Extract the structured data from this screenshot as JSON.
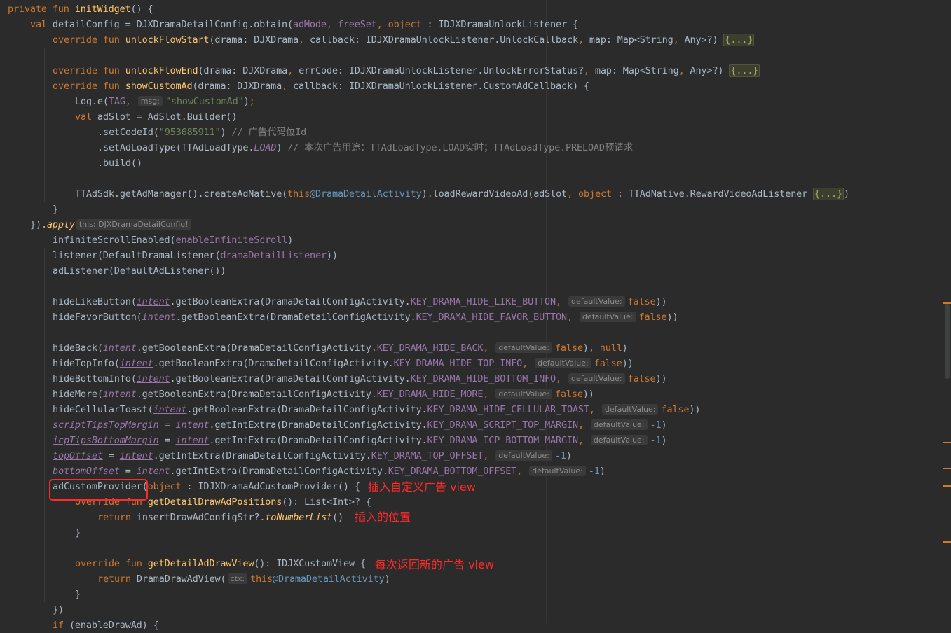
{
  "editor": {
    "lines": [
      [
        [
          "kw",
          "private fun "
        ],
        [
          "fn",
          "initWidget"
        ],
        [
          "",
          "() {"
        ]
      ],
      [
        [
          "kw",
          "val "
        ],
        [
          "",
          "detailConfig = DJXDramaDetailConfig.obtain("
        ],
        [
          "prop",
          "adMode"
        ],
        [
          "kw",
          ", "
        ],
        [
          "prop",
          "freeSet"
        ],
        [
          "kw",
          ", "
        ],
        [
          "kw",
          "object "
        ],
        [
          "",
          ": IDJXDramaUnlockListener {"
        ]
      ],
      [
        [
          "kw",
          "override fun "
        ],
        [
          "fn",
          "unlockFlowStart"
        ],
        [
          "",
          "(drama: DJXDrama"
        ],
        [
          "kw",
          ", "
        ],
        [
          "",
          "callback: IDJXDramaUnlockListener.UnlockCallback"
        ],
        [
          "kw",
          ", "
        ],
        [
          "",
          "map: Map<String"
        ],
        [
          "kw",
          ", "
        ],
        [
          "",
          "Any>?) "
        ],
        [
          "fold",
          "{...}"
        ]
      ],
      [],
      [
        [
          "kw",
          "override fun "
        ],
        [
          "fn",
          "unlockFlowEnd"
        ],
        [
          "",
          "(drama: DJXDrama"
        ],
        [
          "kw",
          ", "
        ],
        [
          "",
          "errCode: IDJXDramaUnlockListener.UnlockErrorStatus?"
        ],
        [
          "kw",
          ", "
        ],
        [
          "",
          "map: Map<String"
        ],
        [
          "kw",
          ", "
        ],
        [
          "",
          "Any>?) "
        ],
        [
          "fold",
          "{...}"
        ]
      ],
      [
        [
          "kw",
          "override fun "
        ],
        [
          "fn",
          "showCustomAd"
        ],
        [
          "",
          "(drama: DJXDrama"
        ],
        [
          "kw",
          ", "
        ],
        [
          "",
          "callback: IDJXDramaUnlockListener.CustomAdCallback) {"
        ]
      ],
      [
        [
          "",
          "Log.e("
        ],
        [
          "prop",
          "TAG"
        ],
        [
          "kw",
          ", "
        ],
        [
          "hint",
          "msg:"
        ],
        [
          "str",
          "\"showCustomAd\""
        ],
        [
          "",
          ")"
        ],
        [
          "kw",
          ";"
        ]
      ],
      [
        [
          "kw",
          "val "
        ],
        [
          "",
          "adSlot = AdSlot.Builder()"
        ]
      ],
      [
        [
          "",
          ".setCodeId("
        ],
        [
          "str",
          "\"953685911\""
        ],
        [
          "",
          ") "
        ],
        [
          "cm",
          "// 广告代码位Id"
        ]
      ],
      [
        [
          "",
          ".setAdLoadType(TTAdLoadType."
        ],
        [
          "iprop",
          "LOAD"
        ],
        [
          "",
          ") "
        ],
        [
          "cm",
          "// 本次广告用途：TTAdLoadType.LOAD实时；TTAdLoadType.PRELOAD预请求"
        ]
      ],
      [
        [
          "",
          ".build()"
        ]
      ],
      [],
      [
        [
          "",
          "TTAdSdk.getAdManager().createAdNative("
        ],
        [
          "kw",
          "this"
        ],
        [
          "label",
          "@DramaDetailActivity"
        ],
        [
          "",
          ").loadRewardVideoAd(adSlot"
        ],
        [
          "kw",
          ", "
        ],
        [
          "kw",
          "object "
        ],
        [
          "",
          ": TTAdNative.RewardVideoAdListener "
        ],
        [
          "fold",
          "{...}"
        ],
        [
          "",
          ")"
        ]
      ],
      [
        [
          "",
          "}"
        ]
      ],
      [
        [
          "",
          "})."
        ],
        [
          "ext",
          "apply"
        ],
        [
          "",
          ""
        ],
        [
          "hint",
          "this: DJXDramaDetailConfig!"
        ],
        [
          "",
          ""
        ]
      ],
      [
        [
          "",
          "infiniteScrollEnabled("
        ],
        [
          "prop",
          "enableInfiniteScroll"
        ],
        [
          "",
          ")"
        ]
      ],
      [
        [
          "",
          "listener(DefaultDramaListener("
        ],
        [
          "prop",
          "dramaDetailListener"
        ],
        [
          "",
          "))"
        ]
      ],
      [
        [
          "",
          "adListener(DefaultAdListener())"
        ]
      ],
      [],
      [
        [
          "",
          "hideLikeButton("
        ],
        [
          "ivar",
          "intent"
        ],
        [
          "",
          ".getBooleanExtra(DramaDetailConfigActivity."
        ],
        [
          "prop",
          "KEY_DRAMA_HIDE_LIKE_BUTTON"
        ],
        [
          "kw",
          ", "
        ],
        [
          "hint",
          "defaultValue:"
        ],
        [
          "kw",
          "false"
        ],
        [
          "",
          "))"
        ]
      ],
      [
        [
          "",
          "hideFavorButton("
        ],
        [
          "ivar",
          "intent"
        ],
        [
          "",
          ".getBooleanExtra(DramaDetailConfigActivity."
        ],
        [
          "prop",
          "KEY_DRAMA_HIDE_FAVOR_BUTTON"
        ],
        [
          "kw",
          ", "
        ],
        [
          "hint",
          "defaultValue:"
        ],
        [
          "kw",
          "false"
        ],
        [
          "",
          "))"
        ]
      ],
      [],
      [
        [
          "",
          "hideBack("
        ],
        [
          "ivar",
          "intent"
        ],
        [
          "",
          ".getBooleanExtra(DramaDetailConfigActivity."
        ],
        [
          "prop",
          "KEY_DRAMA_HIDE_BACK"
        ],
        [
          "kw",
          ", "
        ],
        [
          "hint",
          "defaultValue:"
        ],
        [
          "kw",
          "false"
        ],
        [
          "",
          "), "
        ],
        [
          "kw",
          "null"
        ],
        [
          "",
          ")"
        ]
      ],
      [
        [
          "",
          "hideTopInfo("
        ],
        [
          "ivar",
          "intent"
        ],
        [
          "",
          ".getBooleanExtra(DramaDetailConfigActivity."
        ],
        [
          "prop",
          "KEY_DRAMA_HIDE_TOP_INFO"
        ],
        [
          "kw",
          ", "
        ],
        [
          "hint",
          "defaultValue:"
        ],
        [
          "kw",
          "false"
        ],
        [
          "",
          "))"
        ]
      ],
      [
        [
          "",
          "hideBottomInfo("
        ],
        [
          "ivar",
          "intent"
        ],
        [
          "",
          ".getBooleanExtra(DramaDetailConfigActivity."
        ],
        [
          "prop",
          "KEY_DRAMA_HIDE_BOTTOM_INFO"
        ],
        [
          "kw",
          ", "
        ],
        [
          "hint",
          "defaultValue:"
        ],
        [
          "kw",
          "false"
        ],
        [
          "",
          "))"
        ]
      ],
      [
        [
          "",
          "hideMore("
        ],
        [
          "ivar",
          "intent"
        ],
        [
          "",
          ".getBooleanExtra(DramaDetailConfigActivity."
        ],
        [
          "prop",
          "KEY_DRAMA_HIDE_MORE"
        ],
        [
          "kw",
          ", "
        ],
        [
          "hint",
          "defaultValue:"
        ],
        [
          "kw",
          "false"
        ],
        [
          "",
          "))"
        ]
      ],
      [
        [
          "",
          "hideCellularToast("
        ],
        [
          "ivar",
          "intent"
        ],
        [
          "",
          ".getBooleanExtra(DramaDetailConfigActivity."
        ],
        [
          "prop",
          "KEY_DRAMA_HIDE_CELLULAR_TOAST"
        ],
        [
          "kw",
          ", "
        ],
        [
          "hint",
          "defaultValue:"
        ],
        [
          "kw",
          "false"
        ],
        [
          "",
          "))"
        ]
      ],
      [
        [
          "uvar",
          "scriptTipsTopMargin"
        ],
        [
          "",
          " = "
        ],
        [
          "ivar",
          "intent"
        ],
        [
          "",
          ".getIntExtra(DramaDetailConfigActivity."
        ],
        [
          "prop",
          "KEY_DRAMA_SCRIPT_TOP_MARGIN"
        ],
        [
          "kw",
          ", "
        ],
        [
          "hint",
          "defaultValue:"
        ],
        [
          "num",
          "-1"
        ],
        [
          "",
          ")"
        ]
      ],
      [
        [
          "uvar",
          "icpTipsBottomMargin"
        ],
        [
          "",
          " = "
        ],
        [
          "ivar",
          "intent"
        ],
        [
          "",
          ".getIntExtra(DramaDetailConfigActivity."
        ],
        [
          "prop",
          "KEY_DRAMA_ICP_BOTTOM_MARGIN"
        ],
        [
          "kw",
          ", "
        ],
        [
          "hint",
          "defaultValue:"
        ],
        [
          "num",
          "-1"
        ],
        [
          "",
          ")"
        ]
      ],
      [
        [
          "uvar",
          "topOffset"
        ],
        [
          "",
          " = "
        ],
        [
          "ivar",
          "intent"
        ],
        [
          "",
          ".getIntExtra(DramaDetailConfigActivity."
        ],
        [
          "prop",
          "KEY_DRAMA_TOP_OFFSET"
        ],
        [
          "kw",
          ", "
        ],
        [
          "hint",
          "defaultValue:"
        ],
        [
          "num",
          "-1"
        ],
        [
          "",
          ")"
        ]
      ],
      [
        [
          "uvar",
          "bottomOffset"
        ],
        [
          "",
          " = "
        ],
        [
          "ivar",
          "intent"
        ],
        [
          "",
          ".getIntExtra(DramaDetailConfigActivity."
        ],
        [
          "prop",
          "KEY_DRAMA_BOTTOM_OFFSET"
        ],
        [
          "kw",
          ", "
        ],
        [
          "hint",
          "defaultValue:"
        ],
        [
          "num",
          "-1"
        ],
        [
          "",
          ")"
        ]
      ],
      [
        [
          "",
          "adCustomProvider("
        ],
        [
          "kw",
          "object "
        ],
        [
          "",
          ": IDJXDramaAdCustomProvider() {"
        ]
      ],
      [
        [
          "kw",
          "override fun "
        ],
        [
          "fn",
          "getDetailDrawAdPositions"
        ],
        [
          "",
          "(): List<Int>? {"
        ]
      ],
      [
        [
          "kw",
          "return "
        ],
        [
          "",
          "insertDrawAdConfigStr?."
        ],
        [
          "ext",
          "toNumberList"
        ],
        [
          "",
          "()"
        ]
      ],
      [
        [
          "",
          "}"
        ]
      ],
      [],
      [
        [
          "kw",
          "override fun "
        ],
        [
          "fn",
          "getDetailAdDrawView"
        ],
        [
          "",
          "(): IDJXCustomView {"
        ]
      ],
      [
        [
          "kw",
          "return "
        ],
        [
          "",
          "DramaDrawAdView("
        ],
        [
          "hint",
          "ctx:"
        ],
        [
          "kw",
          "this"
        ],
        [
          "label",
          "@DramaDetailActivity"
        ],
        [
          "",
          ")"
        ]
      ],
      [
        [
          "",
          "}"
        ]
      ],
      [
        [
          "",
          "})"
        ]
      ],
      [
        [
          "kw",
          "if "
        ],
        [
          "",
          "(enableDrawAd) {"
        ]
      ]
    ],
    "indents": [
      0,
      1,
      2,
      0,
      2,
      2,
      3,
      3,
      4,
      4,
      4,
      0,
      3,
      2,
      1,
      2,
      2,
      2,
      0,
      2,
      2,
      0,
      2,
      2,
      2,
      2,
      2,
      2,
      2,
      2,
      2,
      2,
      3,
      4,
      3,
      0,
      3,
      4,
      3,
      2,
      2
    ]
  },
  "annotations": {
    "provider_note": "插入自定义广告 view",
    "position_note": "插入的位置",
    "view_note": "每次返回新的广告 view"
  },
  "colors": {
    "background": "#2b2b2b",
    "keyword": "#cc7832",
    "function": "#ffc66d",
    "string": "#6a8759",
    "comment": "#808080",
    "property": "#9876aa",
    "annotation_red": "#ff2a2a"
  }
}
